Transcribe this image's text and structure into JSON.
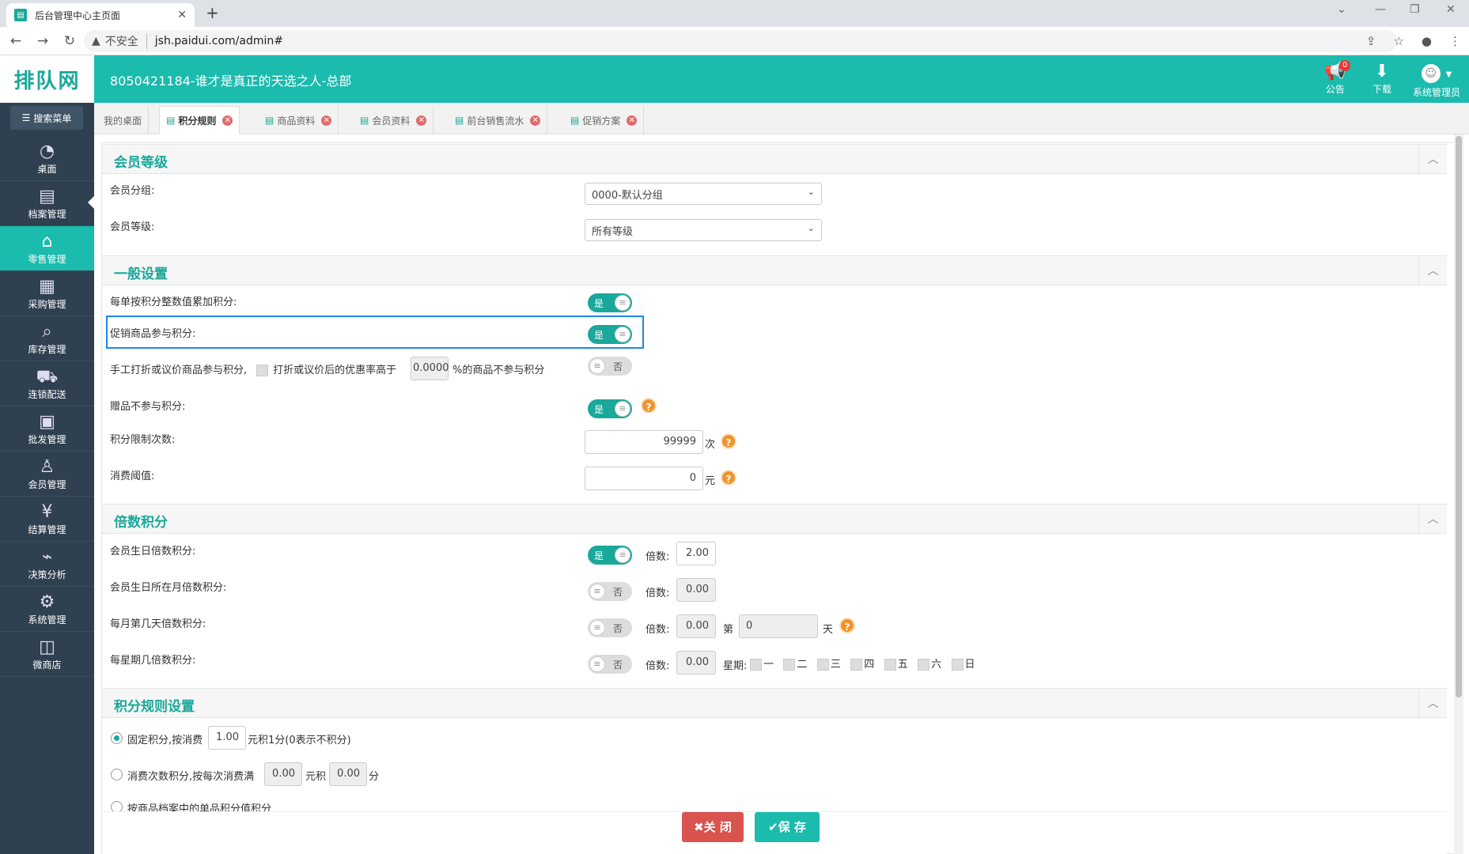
{
  "browser": {
    "tab_title": "后台管理中心主页面",
    "security_label": "不安全",
    "url": "jsh.paidui.com/admin#"
  },
  "header": {
    "logo": "排队网",
    "app_name": "8050421184-谁才是真正的天选之人-总部",
    "notice_label": "公告",
    "notice_count": "0",
    "download_label": "下载",
    "user_label": "系统管理员"
  },
  "sidebar": {
    "search_label": "搜索菜单",
    "items": [
      {
        "label": "桌面"
      },
      {
        "label": "档案管理"
      },
      {
        "label": "零售管理"
      },
      {
        "label": "采购管理"
      },
      {
        "label": "库存管理"
      },
      {
        "label": "连锁配送"
      },
      {
        "label": "批发管理"
      },
      {
        "label": "会员管理"
      },
      {
        "label": "结算管理"
      },
      {
        "label": "决策分析"
      },
      {
        "label": "系统管理"
      },
      {
        "label": "微商店"
      }
    ]
  },
  "tabs": [
    {
      "label": "我的桌面"
    },
    {
      "label": "积分规则"
    },
    {
      "label": "商品资料"
    },
    {
      "label": "会员资料"
    },
    {
      "label": "前台销售流水"
    },
    {
      "label": "促销方案"
    }
  ],
  "member_level": {
    "title": "会员等级",
    "group_label": "会员分组:",
    "group_value": "0000-默认分组",
    "level_label": "会员等级:",
    "level_value": "所有等级"
  },
  "general": {
    "title": "一般设置",
    "row1_label": "每单按积分整数值累加积分:",
    "row1_state": "是",
    "row2_label": "促销商品参与积分:",
    "row2_state": "是",
    "row3_label": "手工打折或议价商品参与积分,",
    "row3_mid": "打折或议价后的优惠率高于",
    "row3_value": "0.0000",
    "row3_suffix": "%的商品不参与积分",
    "row3_state": "否",
    "row4_label": "赠品不参与积分:",
    "row4_state": "是",
    "row5_label": "积分限制次数:",
    "row5_value": "99999",
    "row5_unit": "次",
    "row6_label": "消费阈值:",
    "row6_value": "0",
    "row6_unit": "元"
  },
  "multiple": {
    "title": "倍数积分",
    "multiple_label": "倍数:",
    "row1_label": "会员生日倍数积分:",
    "row1_state": "是",
    "row1_value": "2.00",
    "row2_label": "会员生日所在月倍数积分:",
    "row2_state": "否",
    "row2_value": "0.00",
    "row3_label": "每月第几天倍数积分:",
    "row3_state": "否",
    "row3_value": "0.00",
    "row3_day_prefix": "第",
    "row3_day_value": "0",
    "row3_day_suffix": "天",
    "row4_label": "每星期几倍数积分:",
    "row4_state": "否",
    "row4_value": "0.00",
    "row4_week_label": "星期:",
    "weekdays": [
      "一",
      "二",
      "三",
      "四",
      "五",
      "六",
      "日"
    ]
  },
  "rules": {
    "title": "积分规则设置",
    "opt1_prefix": "固定积分,按消费",
    "opt1_value": "1.00",
    "opt1_suffix": "元积1分(0表示不积分)",
    "opt2_prefix": "消费次数积分,按每次消费满",
    "opt2_value1": "0.00",
    "opt2_mid": "元积",
    "opt2_value2": "0.00",
    "opt2_suffix": "分",
    "opt3_label": "按商品档案中的单品积分值积分"
  },
  "actions": {
    "close_label": "关 闭",
    "save_label": "保 存"
  },
  "colors": {
    "accent": "#1bbbae",
    "sidebar": "#2f4050",
    "close_button": "#d9534f",
    "save_button": "#1bbbae"
  }
}
